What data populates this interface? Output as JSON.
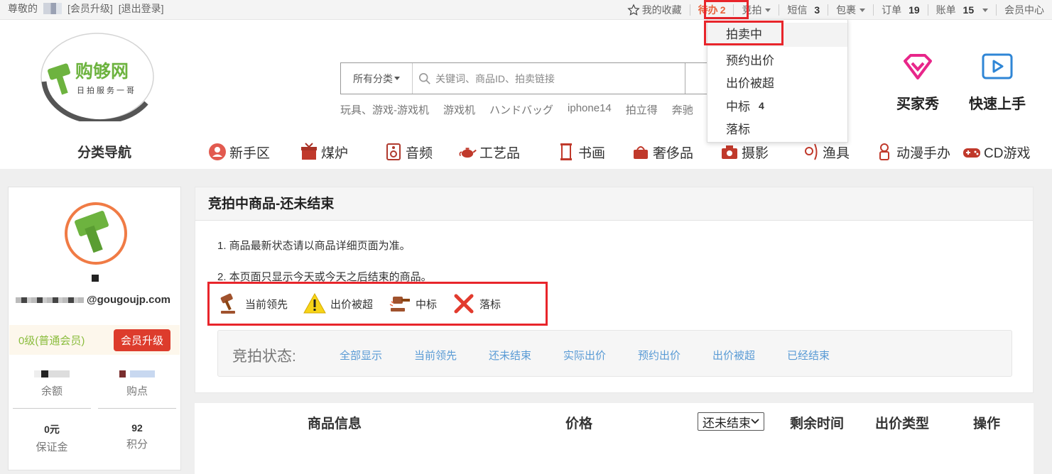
{
  "topbar": {
    "greeting": "尊敬的",
    "vip_upgrade": "[会员升级]",
    "logout": "[退出登录]",
    "favorites": "我的收藏",
    "todo_label": "待办",
    "todo_count": "2",
    "auction": "竞拍",
    "sms_label": "短信",
    "sms_count": "3",
    "package": "包裹",
    "orders_label": "订单",
    "orders_count": "19",
    "bills_label": "账单",
    "bills_count": "15",
    "member_center": "会员中心"
  },
  "auction_menu": {
    "items": [
      {
        "label": "拍卖中",
        "badge": ""
      },
      {
        "label": "预约出价",
        "badge": ""
      },
      {
        "label": "出价被超",
        "badge": ""
      },
      {
        "label": "中标",
        "badge": "4"
      },
      {
        "label": "落标",
        "badge": ""
      }
    ]
  },
  "logo": {
    "name": "购够网",
    "slogan": "日拍服务一哥"
  },
  "search": {
    "category": "所有分类",
    "placeholder": "关键词、商品ID、拍卖链接",
    "hot_keywords": [
      "玩具、游戏-游戏机",
      "游戏机",
      "ハンドバッグ",
      "iphone14",
      "拍立得",
      "奔驰"
    ]
  },
  "promo": {
    "buyer_show": "买家秀",
    "quick_start": "快速上手"
  },
  "nav": {
    "title": "分类导航",
    "items": [
      "新手区",
      "煤炉",
      "音频",
      "工艺品",
      "书画",
      "奢侈品",
      "摄影",
      "渔具",
      "动漫手办",
      "CD游戏"
    ]
  },
  "sidebar": {
    "email": "@gougoujp.com",
    "level": "0级(普通会员)",
    "upgrade": "会员升级",
    "balance_label": "余额",
    "points_label": "购点",
    "deposit_value": "0元",
    "deposit_label": "保证金",
    "score_value": "92",
    "score_label": "积分"
  },
  "panel": {
    "title": "竞拍中商品-还未结束",
    "notice1": "1. 商品最新状态请以商品详细页面为准。",
    "notice2": "2. 本页面只显示今天或今天之后结束的商品。",
    "legend": [
      "当前领先",
      "出价被超",
      "中标",
      "落标"
    ],
    "filter_label": "竞拍状态:",
    "filter_options": [
      "全部显示",
      "当前领先",
      "还未结束",
      "实际出价",
      "预约出价",
      "出价被超",
      "已经结束"
    ]
  },
  "table": {
    "col_item": "商品信息",
    "col_price": "价格",
    "status_select": "还未结束",
    "col_time": "剩余时间",
    "col_bid_type": "出价类型",
    "col_action": "操作"
  },
  "colors": {
    "accent_red": "#e8252b",
    "brand_green": "#6db33f",
    "link_blue": "#5a9bd5",
    "todo_orange": "#e8633d"
  }
}
